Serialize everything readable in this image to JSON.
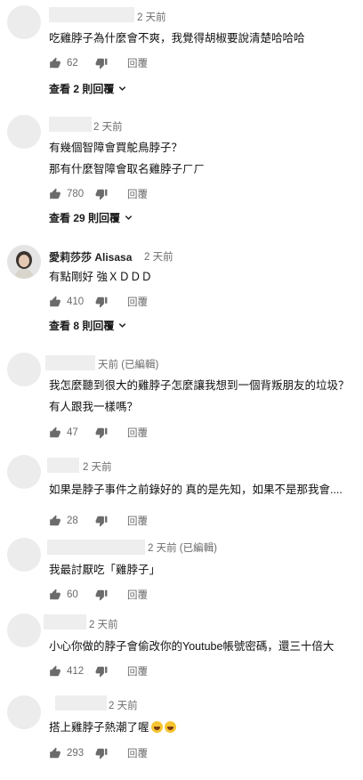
{
  "comments": [
    {
      "date": "2 天前",
      "lines": [
        "吃雞脖子為什麼會不爽，我覺得胡椒要說清楚哈哈哈"
      ],
      "likes": "62",
      "reply": "回覆",
      "view_replies": "查看 2 則回覆"
    },
    {
      "date": "2 天前",
      "lines": [
        "有幾個智障會買鴕鳥脖子？",
        "那有什麼智障會取名雞脖子ㄏㄏ"
      ],
      "likes": "780",
      "reply": "回覆",
      "view_replies": "查看 29 則回覆"
    },
    {
      "author": "愛莉莎莎 Alisasa",
      "date": "2 天前",
      "lines": [
        "有點剛好 強ＸＤＤＤ"
      ],
      "likes": "410",
      "reply": "回覆",
      "view_replies": "查看 8 則回覆"
    },
    {
      "date": "天前 (已編輯)",
      "lines": [
        "我怎麼聽到很大的雞脖子怎麼讓我想到一個背叛朋友的垃圾？",
        "有人跟我一樣嗎？"
      ],
      "likes": "47",
      "reply": "回覆"
    },
    {
      "date": "2 天前",
      "lines": [
        "如果是脖子事件之前錄好的 真的是先知，如果不是那我會...."
      ],
      "likes": "28",
      "reply": "回覆"
    },
    {
      "date": "2 天前 (已編輯)",
      "lines": [
        "我最討厭吃「雞脖子」"
      ],
      "likes": "60",
      "reply": "回覆"
    },
    {
      "date": "2 天前",
      "lines": [
        "小心你做的脖子會偷改你的Youtube帳號密碼，還三十倍大"
      ],
      "likes": "412",
      "reply": "回覆"
    },
    {
      "date": "2 天前",
      "lines": [
        "搭上雞脖子熱潮了喔"
      ],
      "likes": "293",
      "reply": "回覆"
    }
  ],
  "icons": {
    "like": "thumbs-up-icon",
    "dislike": "thumbs-down-icon",
    "expand": "chevron-down-icon",
    "emoji": "laughing-tears-emoji"
  }
}
